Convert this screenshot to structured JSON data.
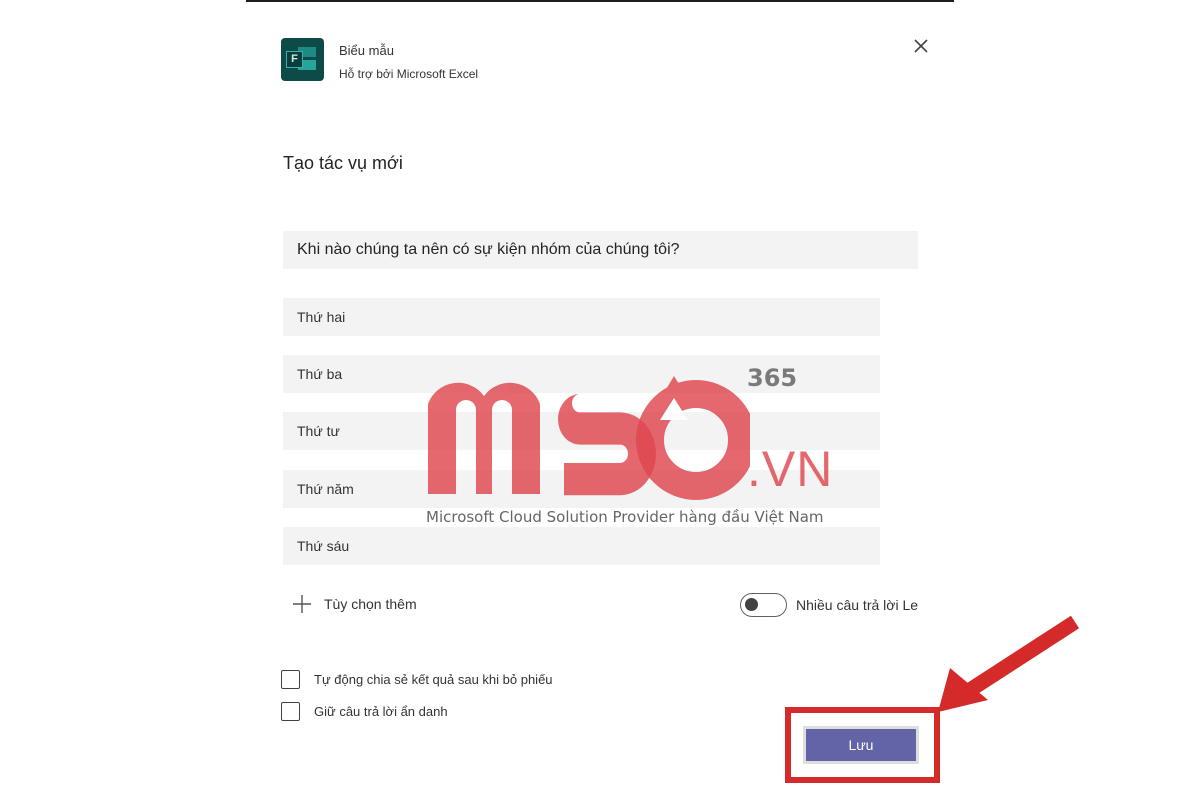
{
  "app": {
    "title": "Biểu mẫu",
    "subtitle": "Hỗ trợ bởi Microsoft Excel",
    "icon": "forms-app-icon",
    "icon_letter": "F",
    "icon_color": "#0e4a48"
  },
  "page": {
    "title": "Tạo tác vụ mới"
  },
  "question": {
    "value": "Khi nào chúng ta nên có sự kiện nhóm của chúng tôi?"
  },
  "options": [
    {
      "label": "Thứ hai"
    },
    {
      "label": "Thứ ba"
    },
    {
      "label": "Thứ tư"
    },
    {
      "label": "Thứ năm"
    },
    {
      "label": "Thứ sáu"
    }
  ],
  "add_option": {
    "label": "Tùy chọn thêm",
    "icon": "plus-icon"
  },
  "multiple_answers": {
    "label": "Nhiều  câu trả lời Le",
    "enabled": false
  },
  "settings": [
    {
      "label": "Tự động chia sẻ kết quả sau khi bỏ phiếu",
      "checked": false
    },
    {
      "label": "Giữ câu trả lời ẩn danh",
      "checked": false
    }
  ],
  "save_button": {
    "label": "Lưu",
    "color": "#6264a7"
  },
  "annotation": {
    "highlight_color": "#d42a2a"
  },
  "watermark": {
    "brand": "MSO",
    "domain": ".VN",
    "edition": "365",
    "tagline": "Microsoft Cloud Solution Provider hàng đầu Việt Nam",
    "color": "#e0474f"
  }
}
